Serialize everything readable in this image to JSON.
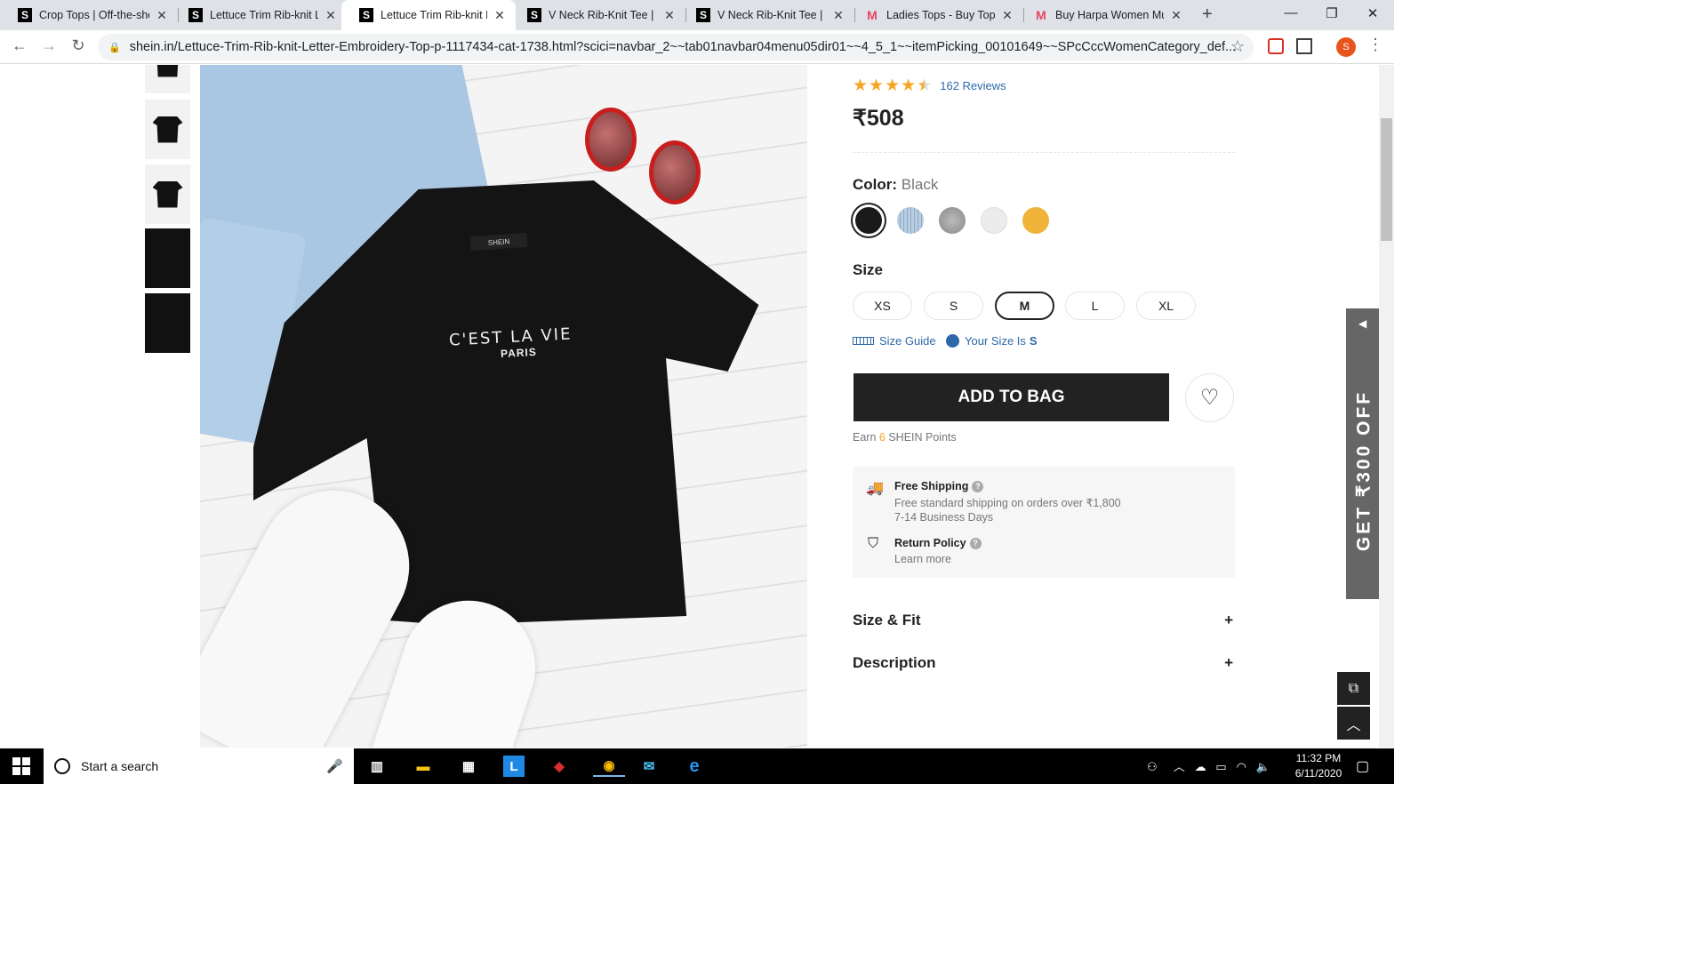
{
  "browser": {
    "tabs": [
      {
        "favicon": "S",
        "title": "Crop Tops | Off-the-sho",
        "active": false
      },
      {
        "favicon": "S",
        "title": "Lettuce Trim Rib-knit Le",
        "active": false
      },
      {
        "favicon": "S",
        "title": "Lettuce Trim Rib-knit Le",
        "active": true
      },
      {
        "favicon": "S",
        "title": "V Neck Rib-Knit Tee | S",
        "active": false
      },
      {
        "favicon": "S",
        "title": "V Neck Rib-Knit Tee | S",
        "active": false
      },
      {
        "favicon": "M",
        "title": "Ladies Tops - Buy Tops",
        "active": false
      },
      {
        "favicon": "M",
        "title": "Buy Harpa Women Mu",
        "active": false
      }
    ],
    "url": "shein.in/Lettuce-Trim-Rib-knit-Letter-Embroidery-Top-p-1117434-cat-1738.html?scici=navbar_2~~tab01navbar04menu05dir01~~4_5_1~~itemPicking_00101649~~SPcCccWomenCategory_def...",
    "profile_initial": "S"
  },
  "product": {
    "shirt_brand_label": "SHEIN",
    "print_line1": "C'EST LA VIE",
    "print_line2": "PARIS",
    "rating": 4.5,
    "reviews": "162 Reviews",
    "price": "₹508",
    "color_label": "Color:",
    "color_value": "Black",
    "colors": [
      {
        "name": "black",
        "hex": "#1a1a1a",
        "selected": true
      },
      {
        "name": "light-blue",
        "hex": "#b9cde0"
      },
      {
        "name": "grey-marl",
        "hex": "#9a9a9a"
      },
      {
        "name": "white",
        "hex": "#ececec"
      },
      {
        "name": "mustard",
        "hex": "#f0b43a"
      }
    ],
    "size_label": "Size",
    "sizes": [
      "XS",
      "S",
      "M",
      "L",
      "XL"
    ],
    "selected_size": "M",
    "size_guide": "Size Guide",
    "your_size_prefix": "Your Size Is",
    "your_size": "S",
    "add_to_bag": "ADD TO BAG",
    "points_prefix": "Earn",
    "points_value": "6",
    "points_suffix": "SHEIN Points",
    "shipping_title": "Free Shipping",
    "shipping_sub1": "Free standard shipping on orders over ₹1,800",
    "shipping_sub2": "7-14 Business Days",
    "return_title": "Return Policy",
    "return_sub": "Learn more",
    "accordion": [
      "Size & Fit",
      "Description"
    ]
  },
  "promo": {
    "text": "GET ₹300 OFF"
  },
  "taskbar": {
    "search_placeholder": "Start a search",
    "time": "11:32 PM",
    "date": "6/11/2020"
  }
}
